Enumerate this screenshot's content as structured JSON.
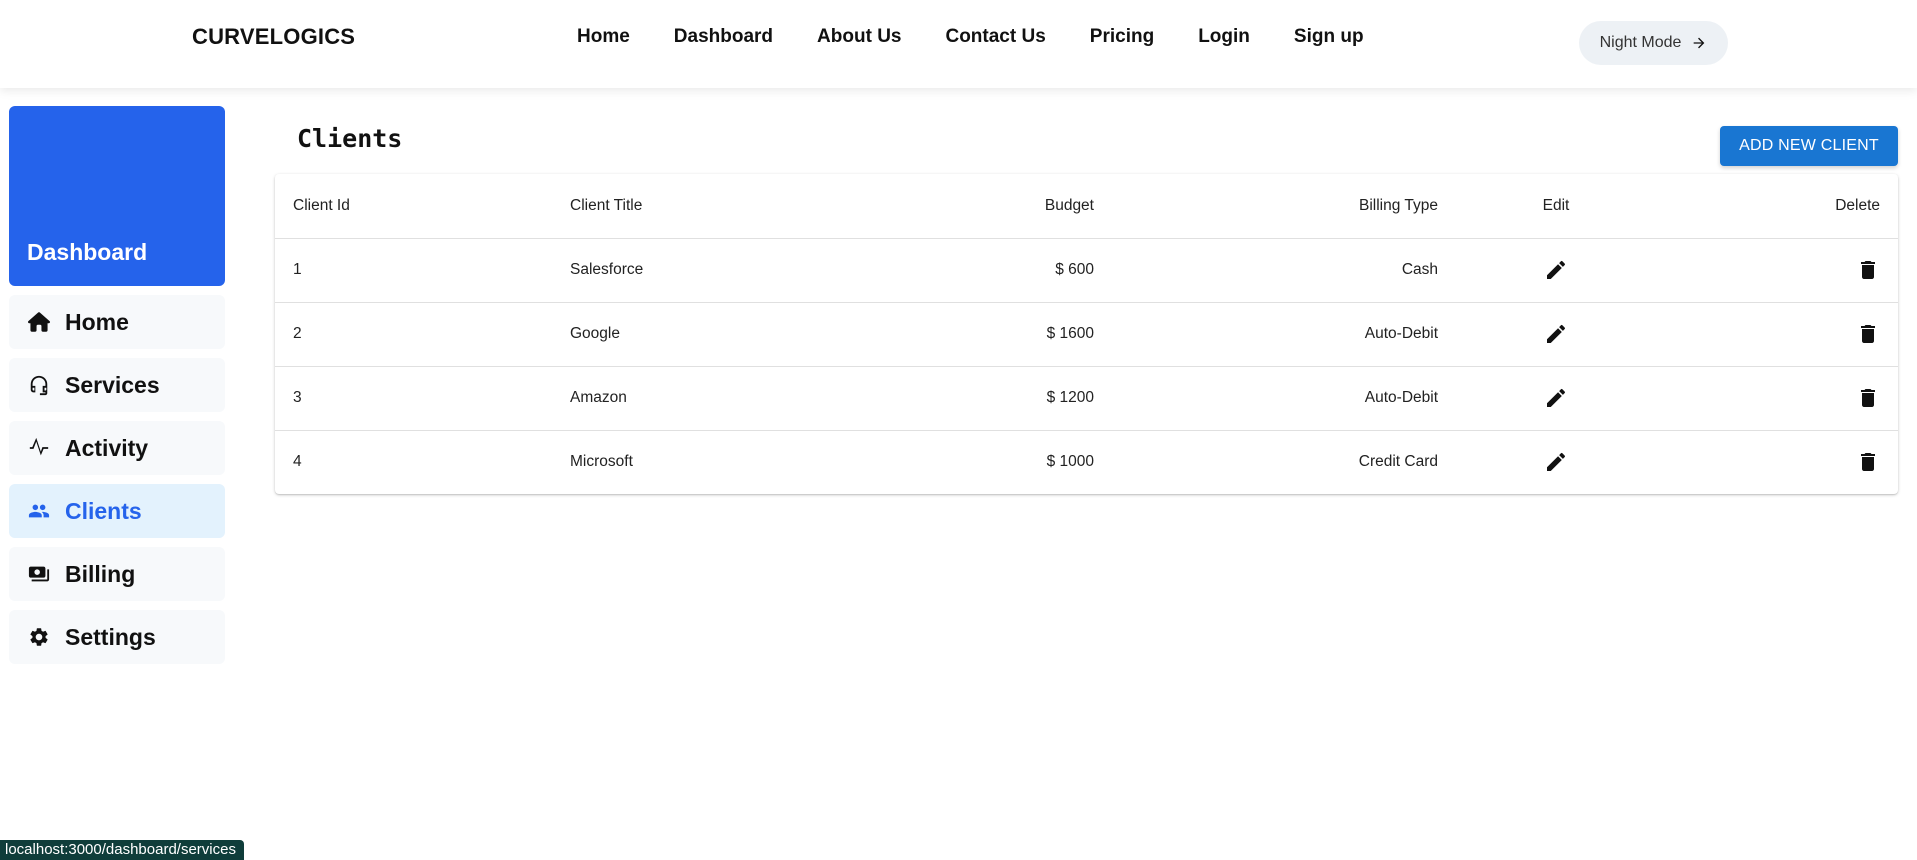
{
  "header": {
    "brand": "CURVELOGICS",
    "nav": [
      "Home",
      "Dashboard",
      "About Us",
      "Contact Us",
      "Pricing",
      "Login",
      "Sign up"
    ],
    "night_mode_label": "Night Mode"
  },
  "sidebar": {
    "title": "Dashboard",
    "items": [
      {
        "label": "Home",
        "icon": "home-icon",
        "active": false
      },
      {
        "label": "Services",
        "icon": "headset-icon",
        "active": false
      },
      {
        "label": "Activity",
        "icon": "activity-icon",
        "active": false
      },
      {
        "label": "Clients",
        "icon": "people-icon",
        "active": true
      },
      {
        "label": "Billing",
        "icon": "money-icon",
        "active": false
      },
      {
        "label": "Settings",
        "icon": "gear-icon",
        "active": false
      }
    ]
  },
  "main": {
    "title": "Clients",
    "add_button_label": "ADD NEW CLIENT",
    "columns": [
      "Client Id",
      "Client Title",
      "Budget",
      "Billing Type",
      "Edit",
      "Delete"
    ],
    "rows": [
      {
        "id": "1",
        "title": "Salesforce",
        "budget": "$ 600",
        "billing": "Cash"
      },
      {
        "id": "2",
        "title": "Google",
        "budget": "$ 1600",
        "billing": "Auto-Debit"
      },
      {
        "id": "3",
        "title": "Amazon",
        "budget": "$ 1200",
        "billing": "Auto-Debit"
      },
      {
        "id": "4",
        "title": "Microsoft",
        "budget": "$ 1000",
        "billing": "Credit Card"
      }
    ]
  },
  "status_bar": {
    "url": "localhost:3000/dashboard/services"
  },
  "colors": {
    "accent": "#2563eb",
    "button": "#1976d2",
    "active_bg": "#e3f2fd"
  }
}
